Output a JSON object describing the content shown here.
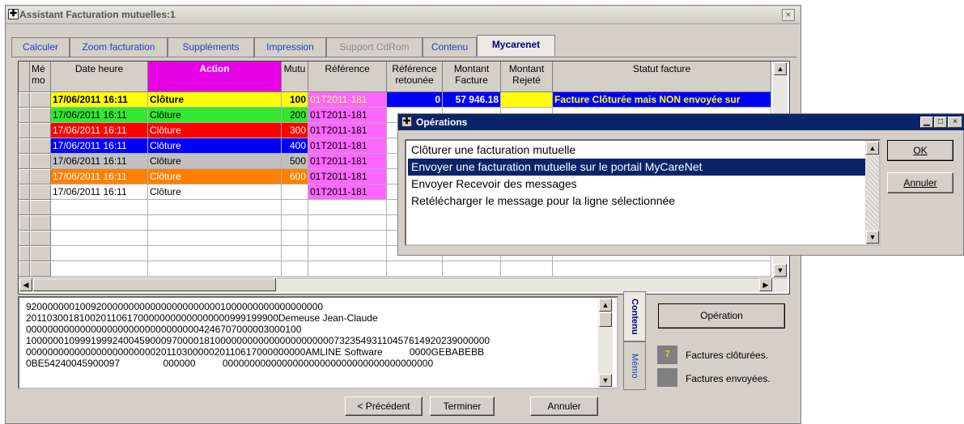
{
  "window": {
    "title": "Assistant Facturation mutuelles:1",
    "close_glyph": "×"
  },
  "tabs": [
    {
      "label": "Calculer",
      "state": "normal"
    },
    {
      "label": "Zoom facturation",
      "state": "normal"
    },
    {
      "label": "Suppléments",
      "state": "normal"
    },
    {
      "label": "Impression",
      "state": "normal"
    },
    {
      "label": "Support CdRom",
      "state": "disabled"
    },
    {
      "label": "Contenu",
      "state": "normal"
    },
    {
      "label": "Mycarenet",
      "state": "active"
    }
  ],
  "grid": {
    "columns": [
      {
        "key": "memo",
        "label": "Mé\nmo"
      },
      {
        "key": "date",
        "label": "Date heure"
      },
      {
        "key": "action",
        "label": "Action"
      },
      {
        "key": "mutu",
        "label": "Mutu"
      },
      {
        "key": "ref",
        "label": "Référence"
      },
      {
        "key": "refret",
        "label": "Référence\nretounée"
      },
      {
        "key": "montant",
        "label": "Montant\nFacture"
      },
      {
        "key": "rejete",
        "label": "Montant\nRejeté"
      },
      {
        "key": "statut",
        "label": "Statut facture"
      }
    ],
    "rows": [
      {
        "date": "17/06/2011 16:11",
        "action": "Clôture",
        "mutu": "100",
        "ref": "01T2011-181",
        "refret": "0",
        "montant": "57 946.18",
        "rejete": "",
        "statut": "Facture Clôturée mais NON envoyée sur",
        "bg": "#ffff00",
        "fg": "#000000",
        "bold": true,
        "refbg": "#ff66ff",
        "reffg": "#ffff66"
      },
      {
        "date": "17/06/2011 16:11",
        "action": "Clôture",
        "mutu": "200",
        "ref": "01T2011-181",
        "refret": "",
        "montant": "",
        "rejete": "",
        "statut": "",
        "bg": "#33e633",
        "fg": "#000000",
        "bold": false,
        "refbg": "#ff66ff",
        "reffg": "#000000"
      },
      {
        "date": "17/06/2011 16:11",
        "action": "Clôture",
        "mutu": "300",
        "ref": "01T2011-181",
        "refret": "",
        "montant": "",
        "rejete": "",
        "statut": "",
        "bg": "#ff0000",
        "fg": "#ffffff",
        "bold": false,
        "refbg": "#ff66ff",
        "reffg": "#000000"
      },
      {
        "date": "17/06/2011 16:11",
        "action": "Clôture",
        "mutu": "400",
        "ref": "01T2011-181",
        "refret": "",
        "montant": "",
        "rejete": "",
        "statut": "",
        "bg": "#0000ff",
        "fg": "#ffffff",
        "bold": false,
        "refbg": "#ff66ff",
        "reffg": "#000000"
      },
      {
        "date": "17/06/2011 16:11",
        "action": "Clôture",
        "mutu": "500",
        "ref": "01T2011-181",
        "refret": "",
        "montant": "",
        "rejete": "",
        "statut": "",
        "bg": "#c0c0c0",
        "fg": "#000000",
        "bold": false,
        "refbg": "#ff66ff",
        "reffg": "#000000"
      },
      {
        "date": "17/06/2011 16:11",
        "action": "Clôture",
        "mutu": "600",
        "ref": "01T2011-181",
        "refret": "",
        "montant": "",
        "rejete": "",
        "statut": "",
        "bg": "#ff8000",
        "fg": "#ffffff",
        "bold": false,
        "refbg": "#ff66ff",
        "reffg": "#000000"
      },
      {
        "date": "17/06/2011 16:11",
        "action": "Clôture",
        "mutu": "",
        "ref": "01T2011-181",
        "refret": "",
        "montant": "",
        "rejete": "",
        "statut": "",
        "bg": "#ffffff",
        "fg": "#000000",
        "bold": false,
        "refbg": "#ff66ff",
        "reffg": "#000000"
      }
    ]
  },
  "memo_lines": [
    "9200000001009200000000000000000000001000000000000000000",
    "20110300181002011061700000000000000000999199900Demeuse Jean-Claude",
    "000000000000000000000000000000004246707000003000100",
    "10000001099919992400459000970000181000000000000000000000073235493110457614920239000000",
    "0000000000000000000000002011030000020110617000000000AMLINE Software          0000GEBABEBB",
    "0BE54240045900097                000000          000000000000000000000000000000000000000"
  ],
  "side_tabs": {
    "contenu": "Contenu",
    "memo": "Mémo"
  },
  "operation_button": "Opération",
  "legend": [
    {
      "count": "7",
      "label": "Factures clôturées.",
      "color": "#808080",
      "textcolor": "#ffff00"
    },
    {
      "count": "",
      "label": "Factures envoyées.",
      "color": "#808080",
      "textcolor": "#ffffff"
    }
  ],
  "footer": {
    "prev": "< Précédent",
    "finish": "Terminer",
    "cancel": "Annuler"
  },
  "dialog": {
    "title": "Opérations",
    "options": [
      "Clôturer une facturation mutuelle",
      "Envoyer une facturation mutuelle sur le portail MyCareNet",
      "Envoyer Recevoir des messages",
      "Retélécharger le message pour la ligne sélectionnée"
    ],
    "selected_index": 1,
    "ok": "OK",
    "cancel": "Annuler"
  }
}
